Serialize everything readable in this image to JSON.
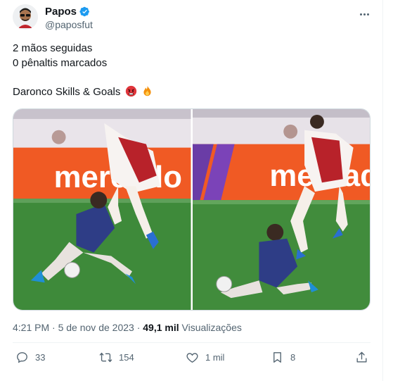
{
  "author": {
    "name": "Papos",
    "handle": "@paposfut",
    "verified": true
  },
  "tweet": {
    "lines": [
      "2 mãos seguidas",
      "0 pênaltis marcados",
      "Daronco Skills & Goals"
    ],
    "emojis": [
      "angry-face-emoji",
      "fire-emoji"
    ]
  },
  "media": {
    "images": [
      "football-match-frame-1",
      "football-match-frame-2"
    ],
    "banner_text": "mercado"
  },
  "meta": {
    "time": "4:21 PM",
    "separator": "·",
    "date": "5 de nov de 2023",
    "views_count": "49,1 mil",
    "views_label": "Visualizações"
  },
  "actions": {
    "replies": "33",
    "retweets": "154",
    "likes": "1 mil",
    "bookmarks": "8"
  },
  "colors": {
    "text": "#0f1419",
    "secondary": "#536471",
    "verified": "#1d9bf0",
    "border": "#cfd9de"
  }
}
